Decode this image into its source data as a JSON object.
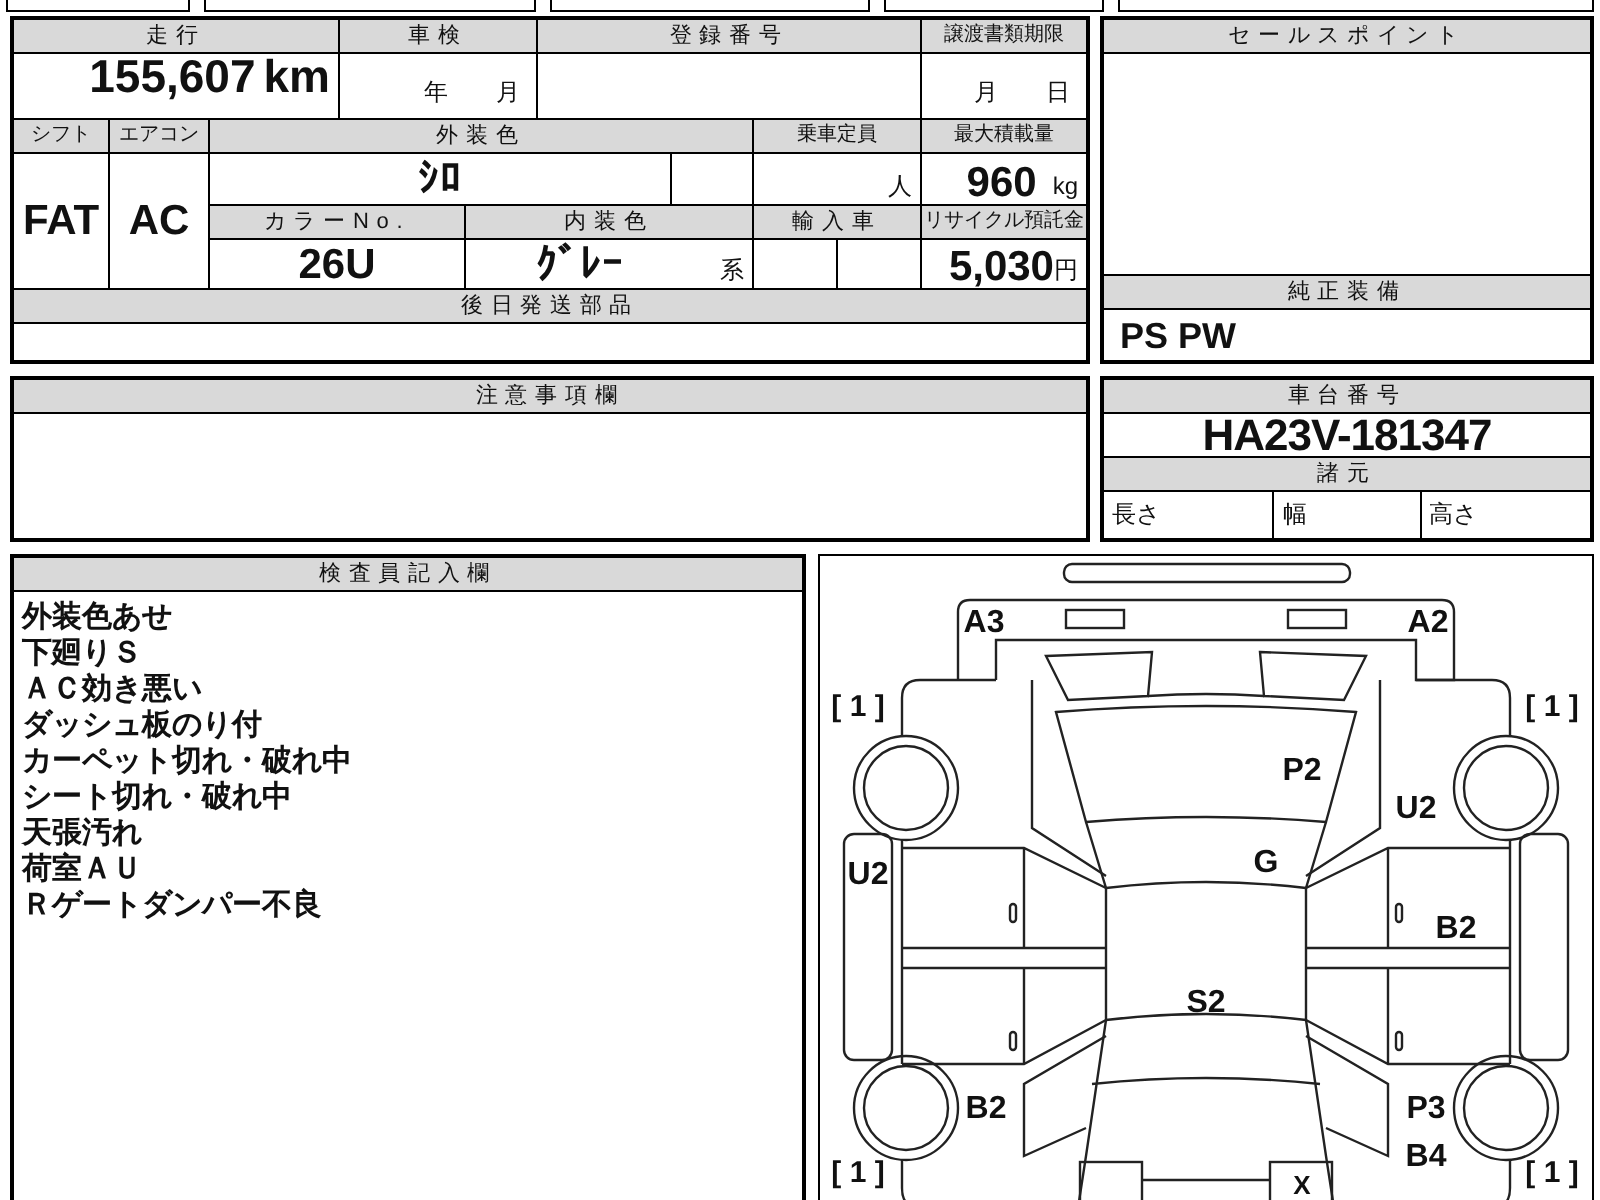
{
  "mileage": {
    "label": "走行",
    "value": "155,607",
    "unit": "km"
  },
  "inspection": {
    "label": "車検",
    "year_unit": "年",
    "month_unit": "月"
  },
  "registration": {
    "label": "登録番号"
  },
  "transfer_deadline": {
    "label": "譲渡書類期限",
    "month_unit": "月",
    "day_unit": "日"
  },
  "shift": {
    "label": "シフト",
    "value": "FAT"
  },
  "aircon": {
    "label": "エアコン",
    "value": "AC"
  },
  "exterior_color": {
    "label": "外装色",
    "value": "ｼﾛ"
  },
  "capacity": {
    "label": "乗車定員",
    "unit": "人"
  },
  "max_load": {
    "label": "最大積載量",
    "value": "960",
    "unit": "kg"
  },
  "color_no": {
    "label": "カラーNo.",
    "value": "26U"
  },
  "interior_color": {
    "label": "内装色",
    "value": "ｸﾞﾚｰ",
    "suffix": "系"
  },
  "imported": {
    "label": "輸入車"
  },
  "recycle_fee": {
    "label": "リサイクル預託金",
    "value": "5,030",
    "unit": "円"
  },
  "parts_to_ship": {
    "label": "後日発送部品"
  },
  "sales_points": {
    "label": "セールスポイント"
  },
  "standard_equipment": {
    "label": "純正装備",
    "value": "PS PW"
  },
  "notes": {
    "label": "注意事項欄"
  },
  "chassis": {
    "label": "車台番号",
    "value": "HA23V-181347"
  },
  "specs": {
    "label": "諸元",
    "items": [
      "長さ",
      "幅",
      "高さ"
    ]
  },
  "inspector": {
    "label": "検査員記入欄",
    "lines": [
      "外装色あせ",
      "下廻りＳ",
      "ＡＣ効き悪い",
      "ダッシュ板のり付",
      "カーペット切れ・破れ中",
      "シート切れ・破れ中",
      "天張汚れ",
      "荷室ＡＵ",
      "Ｒゲートダンパー不良"
    ]
  },
  "diagram": {
    "tire_grades": [
      "[ 1 ]",
      "[ 1 ]",
      "[ 1 ]",
      "[ 1 ]"
    ],
    "marks": [
      {
        "code": "A3"
      },
      {
        "code": "A2"
      },
      {
        "code": "P2"
      },
      {
        "code": "U2"
      },
      {
        "code": "U2"
      },
      {
        "code": "G"
      },
      {
        "code": "B2"
      },
      {
        "code": "S2"
      },
      {
        "code": "B2"
      },
      {
        "code": "P3"
      },
      {
        "code": "B4"
      },
      {
        "code": "X"
      }
    ]
  }
}
